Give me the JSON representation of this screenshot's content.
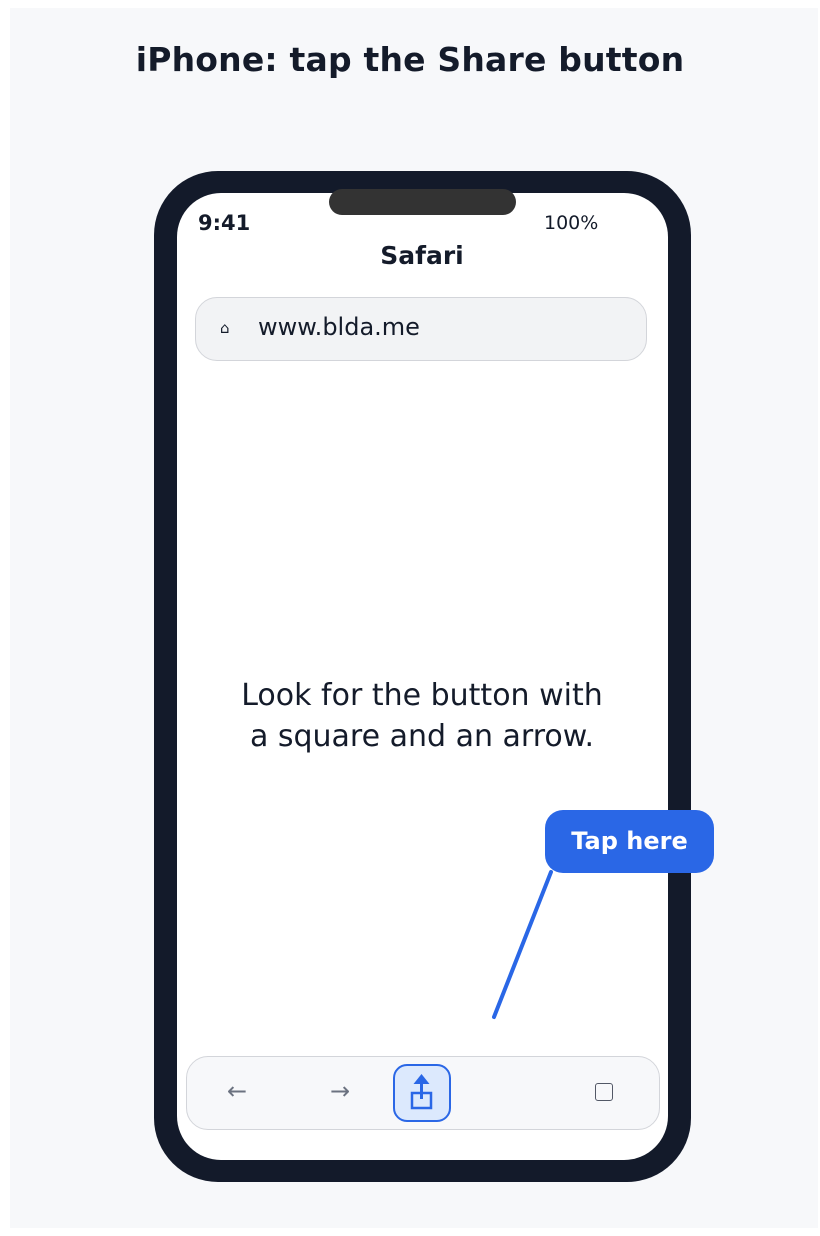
{
  "page": {
    "title": "iPhone: tap the Share button"
  },
  "phone": {
    "status_time": "9:41",
    "status_battery": "100%",
    "app_title": "Safari",
    "address_bar": {
      "icon": "home-icon",
      "url": "www.blda.me"
    },
    "hint_line1": "Look for the button with",
    "hint_line2": "a square and an arrow.",
    "callout_label": "Tap here",
    "toolbar": {
      "back_icon": "←",
      "forward_icon": "→",
      "share_icon": "share-icon",
      "tabs_icon": "tabs-icon"
    }
  },
  "colors": {
    "accent": "#2a67e6",
    "phone_frame": "#131a2a",
    "background": "#f7f8fa",
    "share_highlight": "#dce9fd"
  }
}
